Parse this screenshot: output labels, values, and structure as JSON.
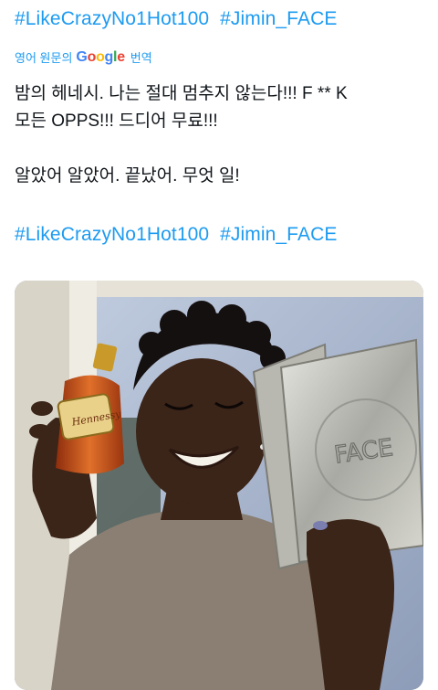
{
  "hashtags_top": [
    "#LikeCrazyNo1Hot100",
    "#Jimin_FACE"
  ],
  "translation_bar": {
    "label": "영어 원문의",
    "google_letters": [
      "G",
      "o",
      "o",
      "g",
      "l",
      "e"
    ],
    "action": "번역"
  },
  "tweet_lines": [
    "밤의 헤네시. 나는 절대 멈추지 않는다!!! F ** K",
    "모든 OPPS!!! 드디어 무료!!!",
    "알았어 알았어. 끝났어. 무엇 일!"
  ],
  "hashtags_bottom": [
    "#LikeCrazyNo1Hot100",
    "#Jimin_FACE"
  ],
  "media": {
    "bottle_label": "Hennessy",
    "album_text": "FACE",
    "colors": {
      "sky": "#a9b7cf",
      "wall": "#d9d4c8",
      "shirt": "#8a7f72",
      "skin": "#3b2418",
      "hair": "#151010",
      "bottle": "#c8521c",
      "label": "#e9d18a",
      "album": "#c9c9c2"
    }
  }
}
